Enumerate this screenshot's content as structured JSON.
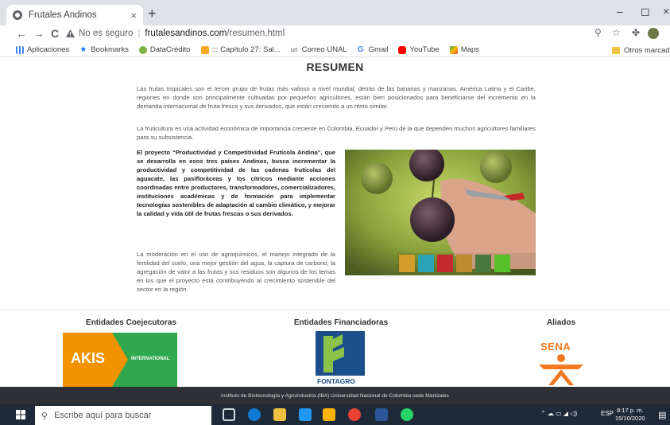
{
  "browser": {
    "tab_title": "Frutales Andinos",
    "tab_close": "×",
    "new_tab": "+",
    "window_min": "–",
    "window_max": "◻",
    "window_close": "×",
    "nav_back": "←",
    "nav_forward": "→",
    "nav_reload": "C",
    "security_text": "No es seguro",
    "url_host": "frutalesandinos.com",
    "url_path": "/resumen.html"
  },
  "bookmarks": {
    "items": [
      "Aplicaciones",
      "Bookmarks",
      "DataCrédito",
      "::: Capítulo 27: Sal...",
      "Correo UNAL",
      "Gmail",
      "YouTube",
      "Maps"
    ],
    "other": "Otros marcadores"
  },
  "page": {
    "title": "RESUMEN",
    "paragraph1": "Las frutas tropicales son el tercer grupo de frutas más valioso a nivel mundial, detrás de las bananas y manzanas. América Latina y el Caribe, regiones en donde son principalmente cultivadas por pequeños agricultores, están bien posicionados para beneficiarse del incremento en la demanda internacional de fruta fresca y sus derivados, que están creciendo a un ritmo similar.",
    "paragraph2": "La fruticultura es una actividad económica de importancia creciente en Colombia, Ecuador y Perú de la que dependen muchos agricultores familiares para su subsistencia.",
    "paragraph3": "El proyecto “Productividad y Competitividad Frutícola Andina”, que se desarrolla en esos tres países Andinos, busca incrementar la productividad y competitividad de las cadenas frutícolas del aguacate, las pasifloráceas y los cítricos mediante acciones coordinadas entre productores, transformadores, comercializadores, instituciones académicas y de formación para implementar tecnologías sostenibles de adaptación al cambio climático, y mejorar la calidad y vida útil de frutas frescas o sus derivados.",
    "paragraph4": "La moderación en el uso de agroquímicos, el manejo integrado de la fertilidad del suelo, una mejor gestión del agua, la captura de carbono, la agregación de valor a las frutas y sus residuos son algunos de los temas en los que el proyecto está contribuyendo al crecimiento sostenible del sector en la región.",
    "col1_title": "Entidades Coejecutoras",
    "col2_title": "Entidades Financiadoras",
    "col3_title": "Aliados",
    "akis_main": "AKIS",
    "akis_sub": "INTERNATIONAL",
    "fontagro_label": "FONTAGRO",
    "sena_label": "SENA",
    "footer": "Instituto de Biotecnología y Agroindustria (IBA) Universidad Nacional de Colombia sede Manizales"
  },
  "taskbar": {
    "search_placeholder": "Escribe aquí para buscar",
    "lang": "ESP",
    "time": "8:17 p. m.",
    "date": "15/10/2020"
  },
  "colors": {
    "akis_orange": "#f39200",
    "akis_green": "#2fa84f",
    "fontagro_blue": "#1c4f8a",
    "sena_orange": "#f47920",
    "footer_bg": "#2d3035",
    "taskbar_bg": "#1f2a38"
  }
}
